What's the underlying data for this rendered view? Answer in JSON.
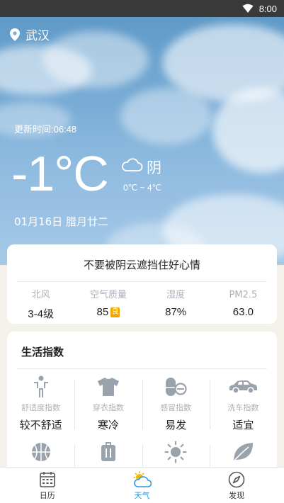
{
  "status_bar": {
    "time": "8:00"
  },
  "header": {
    "city": "武汉",
    "update_time": "更新时间:06:48",
    "temperature": "-1°C",
    "condition": "阴",
    "temp_range": "0℃ ~ 4℃",
    "date": "01月16日 腊月廿二"
  },
  "summary": {
    "slogan": "不要被阴云遮挡住好心情",
    "stats": [
      {
        "label": "北风",
        "value": "3-4级"
      },
      {
        "label": "空气质量",
        "value": "85",
        "badge": "良"
      },
      {
        "label": "湿度",
        "value": "87%"
      },
      {
        "label": "PM2.5",
        "value": "63.0"
      }
    ]
  },
  "life": {
    "title": "生活指数",
    "items": [
      {
        "label": "舒适度指数",
        "value": "较不舒适",
        "icon": "person-icon"
      },
      {
        "label": "穿衣指数",
        "value": "寒冷",
        "icon": "shirt-icon"
      },
      {
        "label": "感冒指数",
        "value": "易发",
        "icon": "pill-icon"
      },
      {
        "label": "洗车指数",
        "value": "适宜",
        "icon": "car-icon"
      },
      {
        "icon": "basketball-icon"
      },
      {
        "icon": "luggage-icon"
      },
      {
        "icon": "sun-icon"
      },
      {
        "icon": "leaf-icon"
      }
    ]
  },
  "nav": {
    "items": [
      {
        "label": "日历",
        "icon": "calendar-icon"
      },
      {
        "label": "天气",
        "icon": "weather-icon",
        "active": true
      },
      {
        "label": "发现",
        "icon": "compass-icon"
      }
    ]
  },
  "colors": {
    "accent": "#2a9be0",
    "badge": "#f0a500",
    "sky": "#79acd6"
  }
}
